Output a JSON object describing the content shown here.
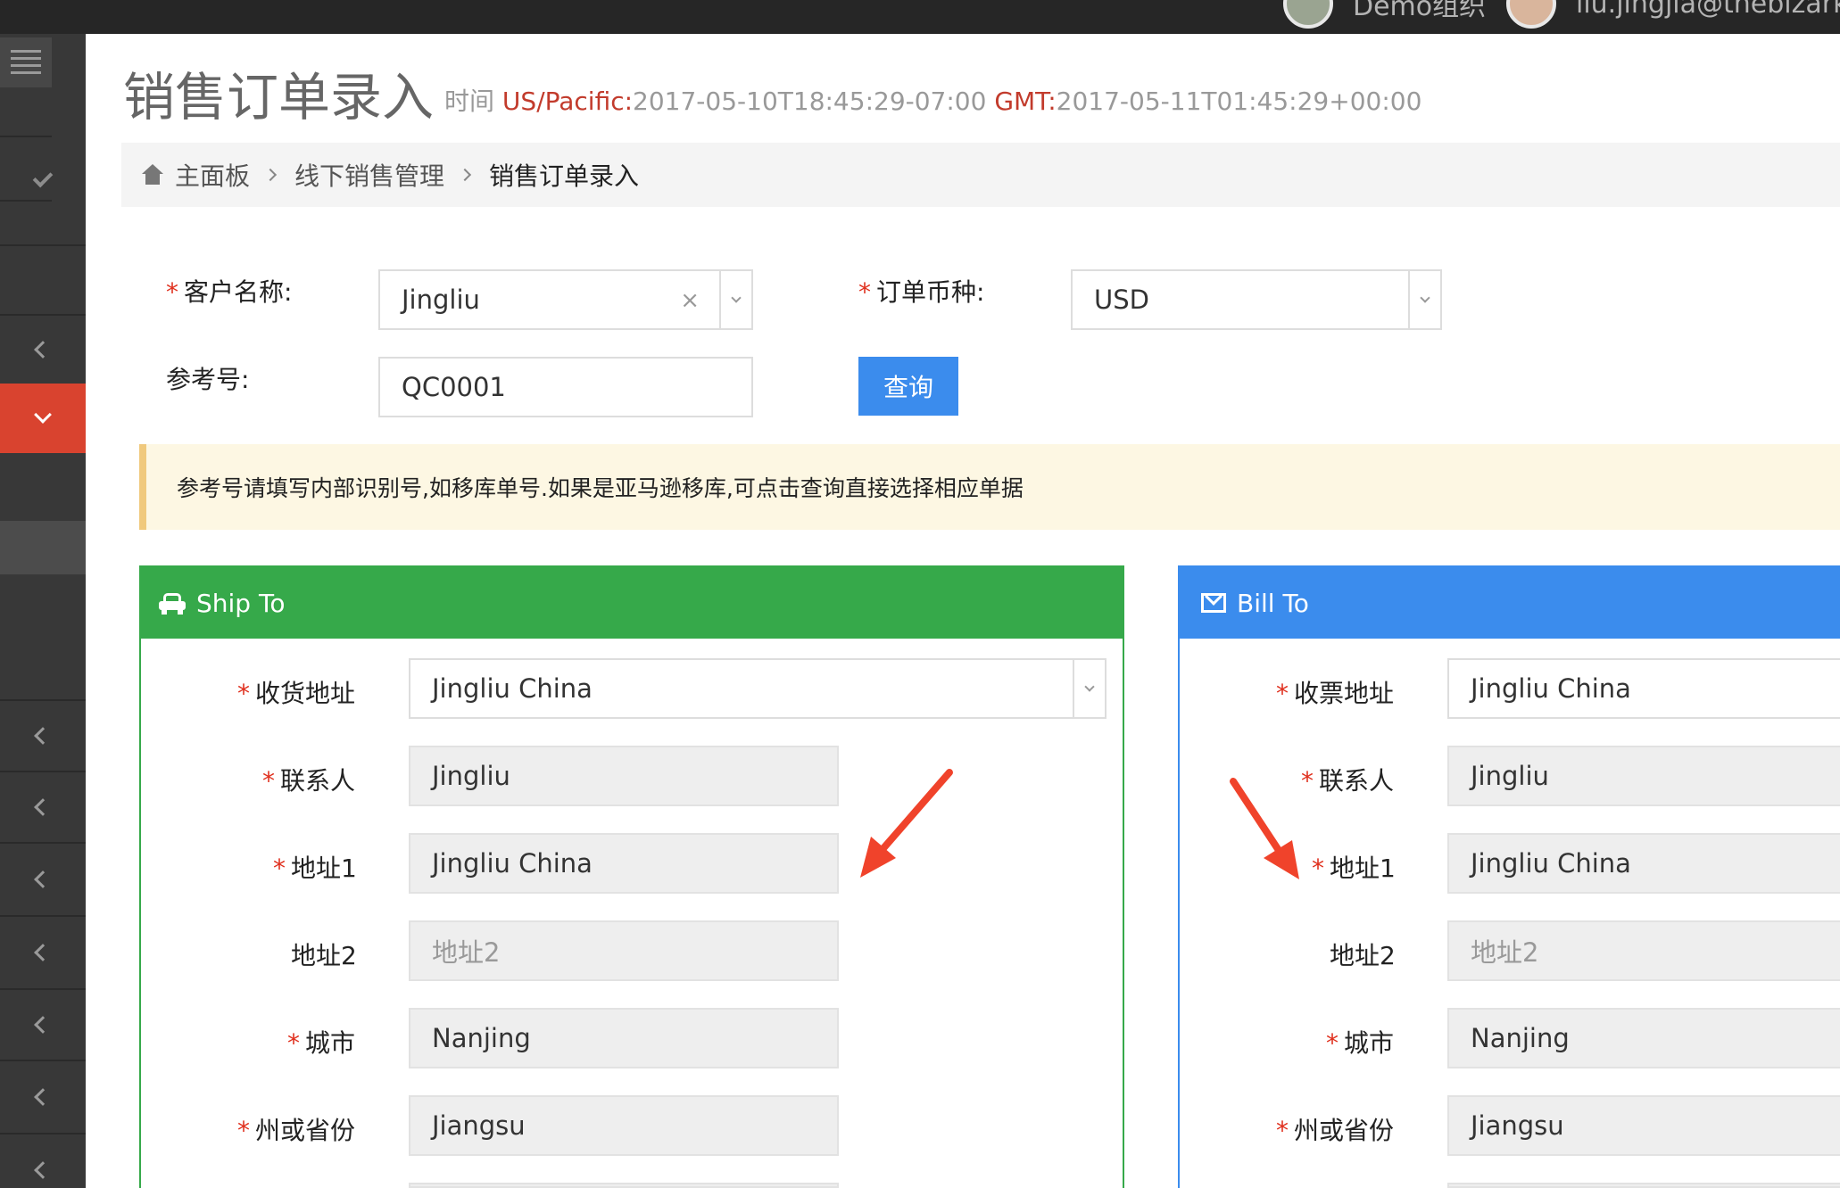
{
  "topbar": {
    "user1_label": "Demo组织",
    "user2_label": "liu.jingjia@thebizark.com"
  },
  "page": {
    "title": "销售订单录入",
    "time_prefix": "时间",
    "tz1_label": "US/Pacific:",
    "tz1_value": "2017-05-10T18:45:29-07:00",
    "tz2_label": "GMT:",
    "tz2_value": "2017-05-11T01:45:29+00:00"
  },
  "breadcrumb": {
    "home": "主面板",
    "section": "线下销售管理",
    "current": "销售订单录入"
  },
  "form": {
    "customer_label": "客户名称:",
    "customer_value": "Jingliu",
    "currency_label": "订单币种:",
    "currency_value": "USD",
    "ref_label": "参考号:",
    "ref_value": "QC0001",
    "query_button": "查询",
    "clear_glyph": "×"
  },
  "notice": "参考号请填写内部识别号,如移库单号.如果是亚马逊移库,可点击查询直接选择相应单据",
  "required_mark": "*",
  "ship_to": {
    "title": "Ship To",
    "address_label": "收货地址",
    "address_value": "Jingliu China",
    "contact_label": "联系人",
    "contact_value": "Jingliu",
    "addr1_label": "地址1",
    "addr1_value": "Jingliu China",
    "addr2_label": "地址2",
    "addr2_placeholder": "地址2",
    "city_label": "城市",
    "city_value": "Nanjing",
    "state_label": "州或省份",
    "state_value": "Jiangsu"
  },
  "bill_to": {
    "title": "Bill To",
    "address_label": "收票地址",
    "address_value": "Jingliu China",
    "contact_label": "联系人",
    "contact_value": "Jingliu",
    "addr1_label": "地址1",
    "addr1_value": "Jingliu China",
    "addr2_label": "地址2",
    "addr2_placeholder": "地址2",
    "city_label": "城市",
    "city_value": "Nanjing",
    "state_label": "州或省份",
    "state_value": "Jiangsu"
  },
  "colors": {
    "ship_header": "#36a94a",
    "bill_header": "#3b8ced",
    "sidebar_active": "#d9432f",
    "annotation_arrow": "#f0432b"
  }
}
